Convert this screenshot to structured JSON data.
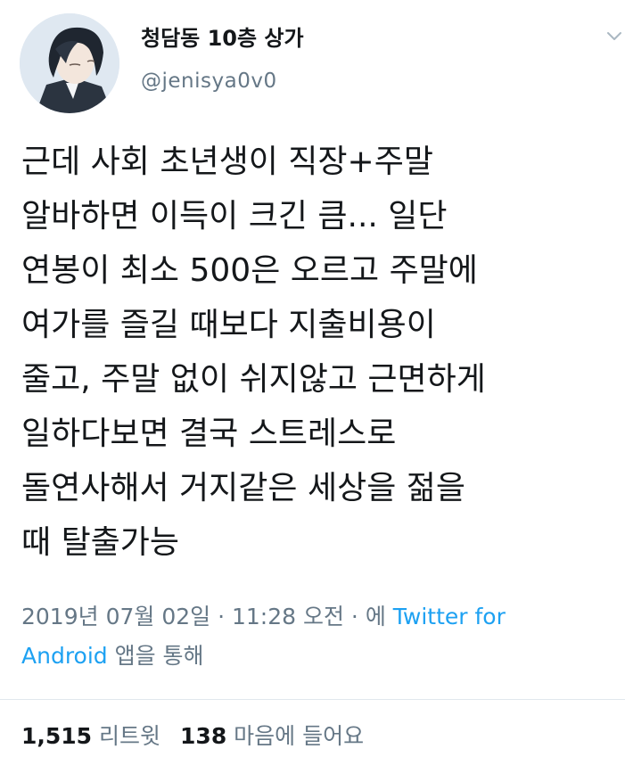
{
  "user": {
    "display_name": "청담동 10층 상가",
    "handle": "@jenisya0v0"
  },
  "tweet": {
    "lines": [
      "근데 사회 초년생이 직장+주말",
      "알바하면 이득이 크긴 큼... 일단",
      "연봉이 최소 500은 오르고 주말에",
      "여가를 즐길 때보다 지출비용이",
      "줄고, 주말 없이 쉬지않고 근면하게",
      "일하다보면 결국 스트레스로",
      "돌연사해서 거지같은 세상을 젊을",
      "때 탈출가능"
    ]
  },
  "meta": {
    "timestamp": "2019년 07월 02일 · 11:28 오전 · 에 ",
    "source_link": "Twitter for",
    "source_link_cont": "Android",
    "via_suffix": " 앱을 통해"
  },
  "stats": {
    "retweets_count": "1,515",
    "retweets_label": " 리트윗",
    "likes_count": "138",
    "likes_label": " 마음에 들어요"
  },
  "icons": {
    "caret": "chevron-down-icon"
  },
  "colors": {
    "text": "#14171a",
    "secondary": "#657786",
    "link": "#1da1f2",
    "divider": "#e1e8ed"
  }
}
